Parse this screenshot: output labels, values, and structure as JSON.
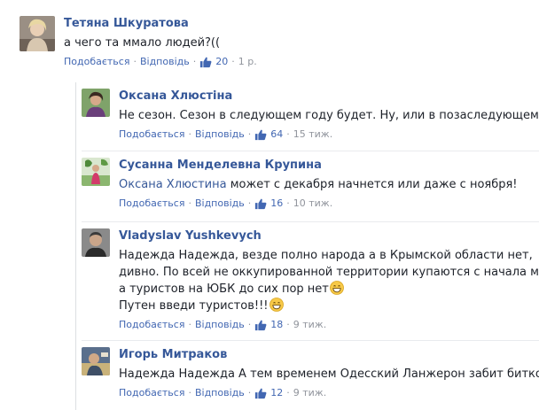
{
  "comments": [
    {
      "author": "Тетяна Шкуратова",
      "text": "а чего та ммало людей?((",
      "like_label": "Подобається",
      "reply_label": "Відповідь",
      "likes": "20",
      "time": "1 р."
    },
    {
      "author": "Оксана Хлюстіна",
      "text": "Не сезон. Сезон в следующем году будет. Ну, или в позаследующем.",
      "like_label": "Подобається",
      "reply_label": "Відповідь",
      "likes": "64",
      "time": "15 тиж."
    },
    {
      "author": "Сусанна Менделевна Крупина",
      "mention": "Оксана Хлюстина",
      "text": " может с декабря начнется или даже с ноября!",
      "like_label": "Подобається",
      "reply_label": "Відповідь",
      "likes": "16",
      "time": "10 тиж."
    },
    {
      "author": "Vladyslav Yushkevych",
      "lines": [
        "Надежда Надежда, везде полно народа а в Крымской области нет,",
        "дивно. По всей не оккупированной территории купаются с начала мая",
        "а туристов на ЮБК до сих пор нет",
        "Путен введи туристов!!!"
      ],
      "like_label": "Подобається",
      "reply_label": "Відповідь",
      "likes": "18",
      "time": "9 тиж."
    },
    {
      "author": "Игорь Митраков",
      "text": "Надежда Надежда А тем временем Одесский Ланжерон забит битком",
      "like_label": "Подобається",
      "reply_label": "Відповідь",
      "likes": "12",
      "time": "9 тиж."
    }
  ],
  "separator": "·",
  "icons": {
    "like": "thumbs-up-icon",
    "emoji": "grinning-face-icon"
  },
  "colors": {
    "link": "#365899",
    "action": "#4267b2",
    "meta": "#90949c"
  }
}
